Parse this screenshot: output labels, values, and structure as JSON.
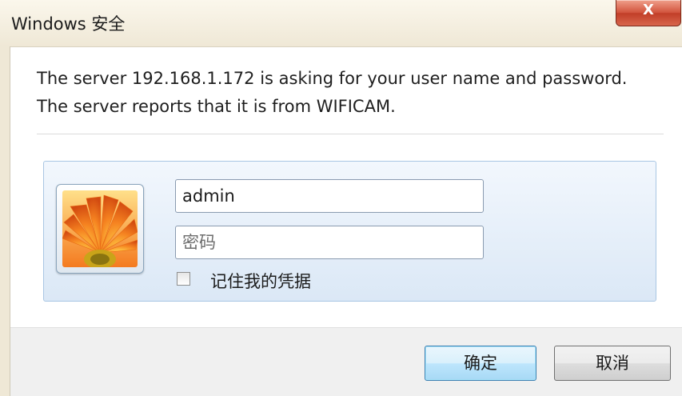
{
  "window": {
    "title": "Windows 安全",
    "close_glyph": "X"
  },
  "message": {
    "text": "The server 192.168.1.172 is asking for your user name and password. The server reports that it is from WIFICAM."
  },
  "credentials": {
    "avatar_icon": "user-tile-flower-icon",
    "username_value": "admin",
    "password_placeholder": "密码",
    "remember_label": "记住我的凭据",
    "remember_checked": false
  },
  "buttons": {
    "ok_label": "确定",
    "cancel_label": "取消"
  },
  "colors": {
    "title_bar": "#efe8d6",
    "close_button": "#c13e28",
    "credential_panel": "#dbe8f6",
    "default_button_border": "#3c7fb1"
  }
}
